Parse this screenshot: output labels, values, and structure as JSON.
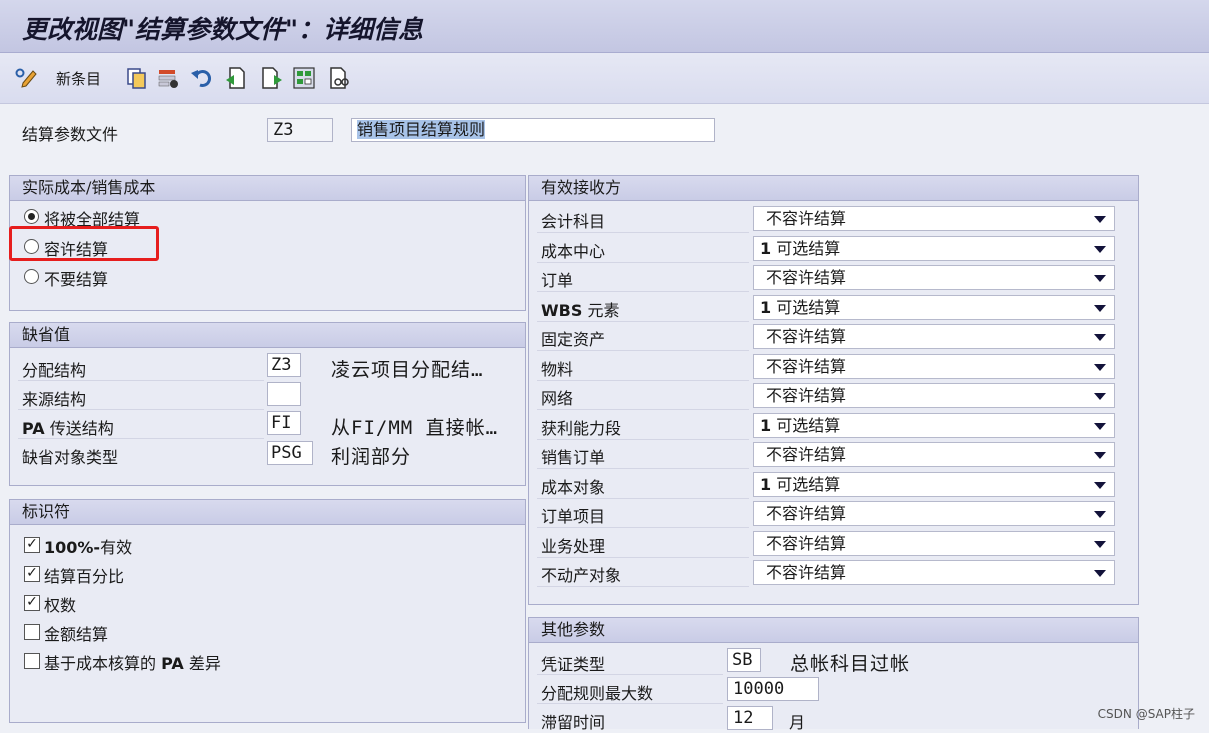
{
  "window": {
    "title": "更改视图\"结算参数文件\"：详细信息"
  },
  "toolbar": {
    "new_entries": "新条目"
  },
  "header": {
    "profile_label": "结算参数文件",
    "profile_code": "Z3",
    "profile_name": "销售项目结算规则"
  },
  "actual_cost": {
    "title": "实际成本/销售成本",
    "options": [
      "将被全部结算",
      "容许结算",
      "不要结算"
    ],
    "selected": "将被全部结算"
  },
  "defaults": {
    "title": "缺省值",
    "rows": [
      {
        "label": "分配结构",
        "value": "Z3",
        "desc": "凌云项目分配结…"
      },
      {
        "label": "来源结构",
        "value": "",
        "desc": ""
      },
      {
        "label_bold": "PA",
        "label_rest": " 传送结构",
        "value": "FI",
        "desc": "从FI/MM 直接帐…"
      },
      {
        "label": "缺省对象类型",
        "value": "PSG",
        "desc": "利润部分"
      }
    ]
  },
  "indicators": {
    "title": "标识符",
    "items": [
      {
        "bold": "100%-",
        "rest": "有效",
        "checked": true
      },
      {
        "bold": "",
        "rest": "结算百分比",
        "checked": true
      },
      {
        "bold": "",
        "rest": "权数",
        "checked": true
      },
      {
        "bold": "",
        "rest": "金额结算",
        "checked": false
      },
      {
        "pre": "基于成本核算的 ",
        "bold": "PA",
        "rest": " 差异",
        "checked": false
      }
    ]
  },
  "receivers": {
    "title": "有效接收方",
    "rows": [
      {
        "label": "会计科目",
        "value": "不容许结算"
      },
      {
        "label": "成本中心",
        "value_bold": "1",
        "value": " 可选结算"
      },
      {
        "label": "订单",
        "value": "不容许结算"
      },
      {
        "label_bold": "WBS",
        "label": " 元素",
        "value_bold": "1",
        "value": " 可选结算"
      },
      {
        "label": "固定资产",
        "value": "不容许结算"
      },
      {
        "label": "物料",
        "value": "不容许结算"
      },
      {
        "label": "网络",
        "value": "不容许结算"
      },
      {
        "label": "获利能力段",
        "value_bold": "1",
        "value": " 可选结算"
      },
      {
        "label": "销售订单",
        "value": "不容许结算"
      },
      {
        "label": "成本对象",
        "value_bold": "1",
        "value": " 可选结算"
      },
      {
        "label": "订单项目",
        "value": "不容许结算"
      },
      {
        "label": "业务处理",
        "value": "不容许结算"
      },
      {
        "label": "不动产对象",
        "value": "不容许结算"
      }
    ]
  },
  "other": {
    "title": "其他参数",
    "doc_type_label": "凭证类型",
    "doc_type_value": "SB",
    "doc_type_desc": "总帐科目过帐",
    "max_rules_label": "分配规则最大数",
    "max_rules_value": "10000",
    "residence_label": "滞留时间",
    "residence_value": "12",
    "residence_unit": "月"
  },
  "watermark": "CSDN @SAP柱子",
  "colors": {
    "highlight": "#e61d1d",
    "panel_head": "#c9cce6"
  }
}
